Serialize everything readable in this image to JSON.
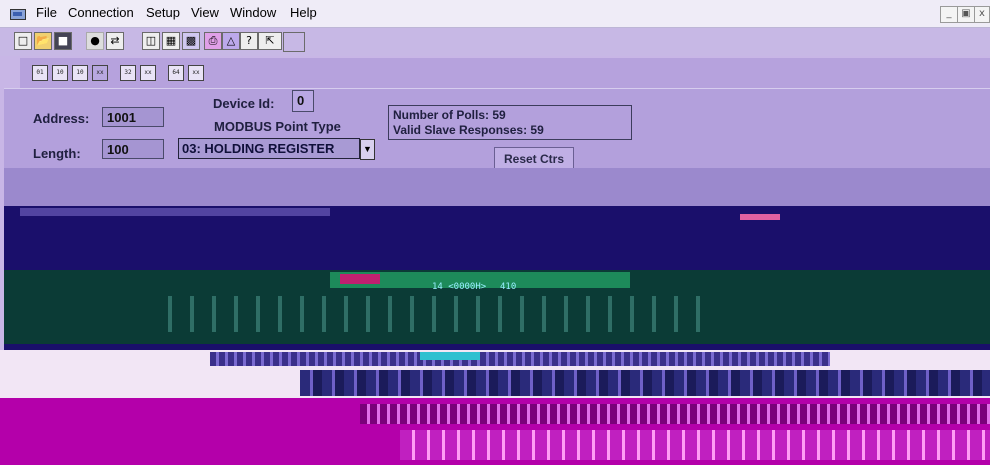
{
  "menu": {
    "items": [
      "File",
      "Connection",
      "Setup",
      "View",
      "Window",
      "Help"
    ]
  },
  "window_controls": {
    "minimize": "_",
    "restore": "̅",
    "close": "x"
  },
  "form": {
    "device_id_label": "Device Id:",
    "device_id_value": "0",
    "address_label": "Address:",
    "address_value": "1001",
    "point_type_label": "MODBUS Point Type",
    "length_label": "Length:",
    "length_value": "100",
    "point_type_value": "03: HOLDING REGISTER"
  },
  "stats": {
    "polls_label": "Number of Polls: 59",
    "responses_label": "Valid Slave Responses: 59"
  },
  "reset_button": "Reset Ctrs",
  "data_fragments": [
    "14  <0000H>",
    "410"
  ],
  "colors": {
    "background": "#c8b6e6",
    "panel": "#b3a0dc",
    "data_area": "#1a0f6b",
    "row_band": "#0b3b36",
    "lower_band": "#b400aa"
  }
}
